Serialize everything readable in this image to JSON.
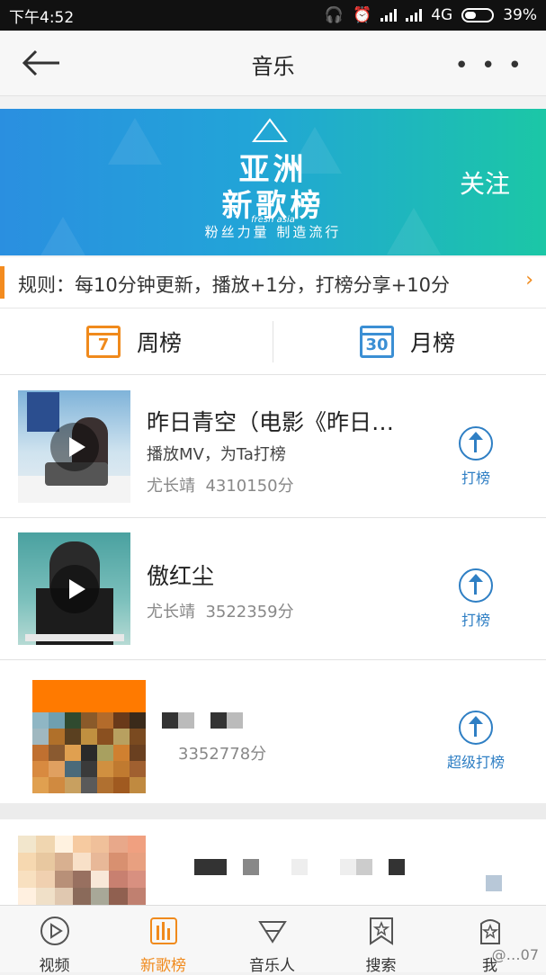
{
  "status_bar": {
    "time": "下午4:52",
    "network": "4G",
    "battery": "39%"
  },
  "header": {
    "title": "音乐",
    "more_icon": "more-dots-icon",
    "back_icon": "back-arrow-icon"
  },
  "banner": {
    "logo_line1": "亚洲",
    "logo_line2": "新歌榜",
    "logo_en": "fresh asia",
    "slogan": "粉丝力量  制造流行",
    "follow": "关注"
  },
  "rules": {
    "text": "规则：每10分钟更新，播放+1分，打榜分享+10分"
  },
  "tabs": [
    {
      "label": "周榜",
      "icon_num": "7",
      "color": "#f08a1c"
    },
    {
      "label": "月榜",
      "icon_num": "30",
      "color": "#3b8fd4"
    }
  ],
  "songs": [
    {
      "title": "昨日青空（电影《昨日…",
      "subtitle": "播放MV，为Ta打榜",
      "artist": "尤长靖",
      "score": "4310150分",
      "vote_label": "打榜"
    },
    {
      "title": "傲红尘",
      "artist": "尤长靖",
      "score": "3522359分",
      "vote_label": "打榜"
    },
    {
      "score": "3352778分",
      "vote_label": "超级打榜"
    }
  ],
  "bottom_nav": [
    {
      "label": "视频",
      "icon": "video-icon"
    },
    {
      "label": "新歌榜",
      "icon": "chart-icon",
      "active": true
    },
    {
      "label": "音乐人",
      "icon": "musician-icon"
    },
    {
      "label": "搜索",
      "icon": "search-icon"
    },
    {
      "label": "我",
      "icon": "profile-icon"
    }
  ],
  "watermark": "@…07"
}
